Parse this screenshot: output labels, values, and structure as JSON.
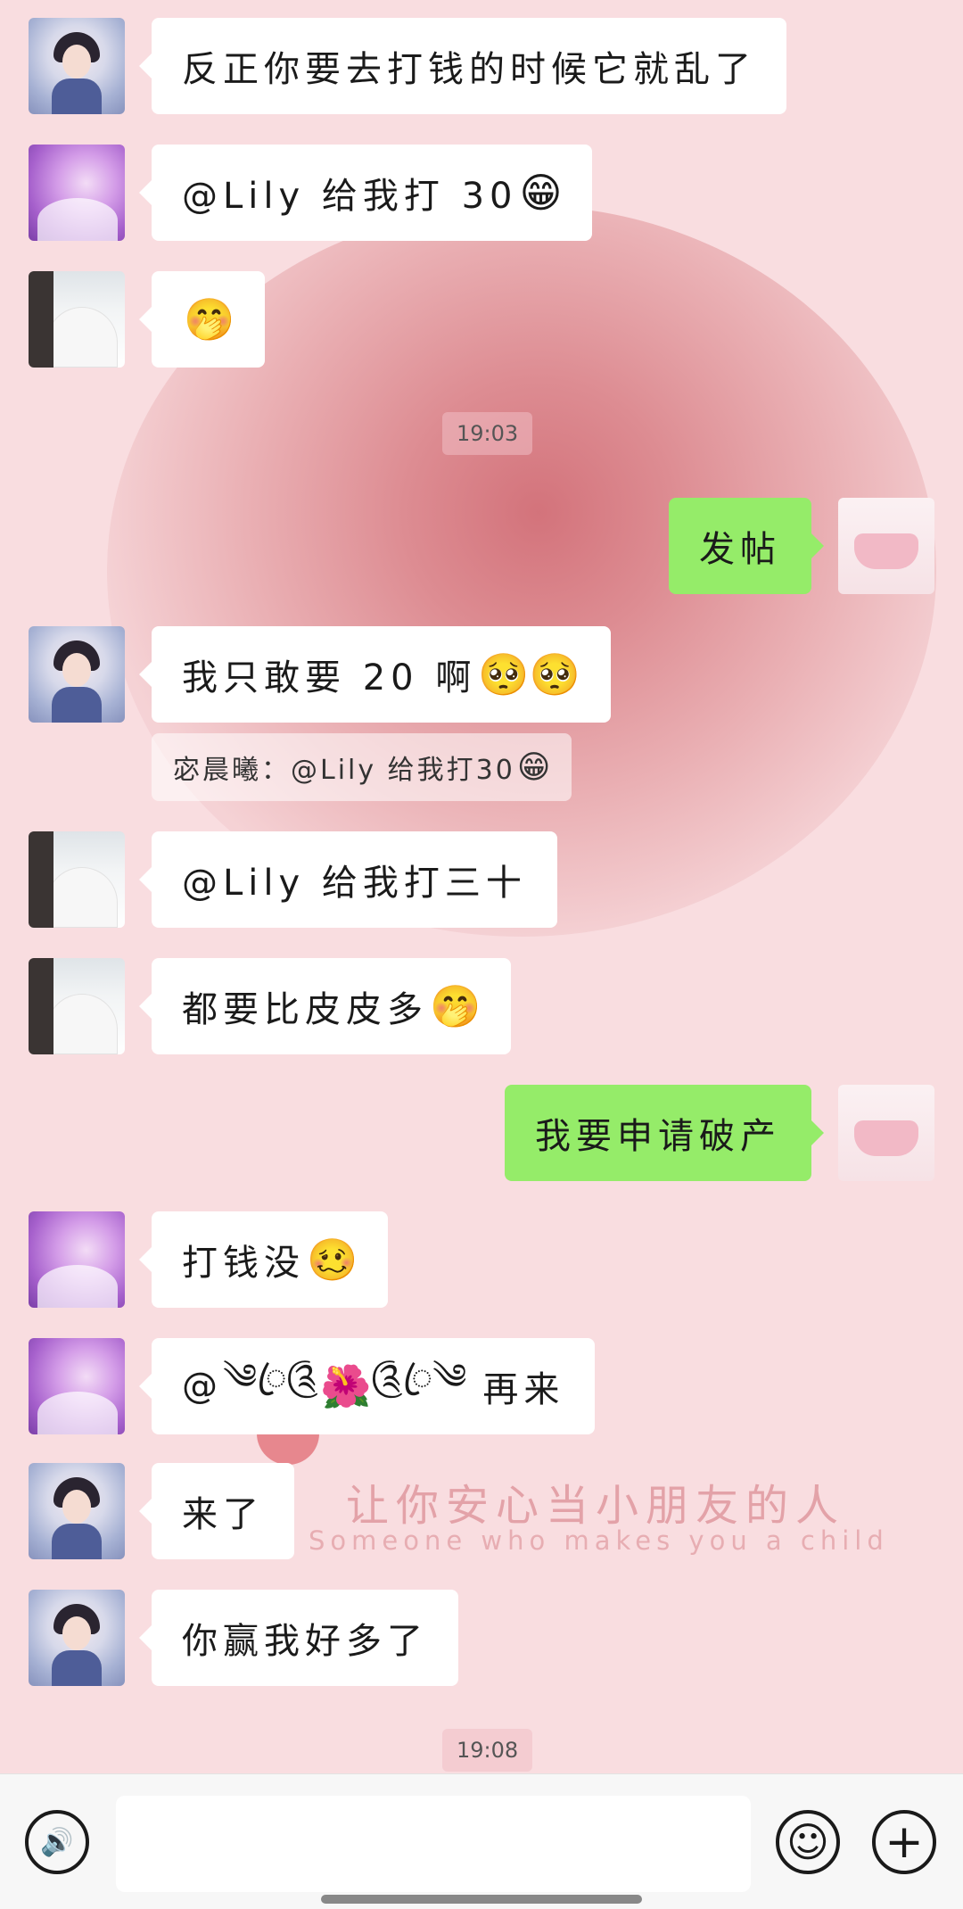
{
  "colors": {
    "background": "#f9dde0",
    "incoming_bubble": "#ffffff",
    "outgoing_bubble": "#95ec69",
    "bottom_bar": "#f7f7f7"
  },
  "watermark": {
    "chinese": "让你安心当小朋友的人",
    "english": "Someone who makes you a child"
  },
  "messages": [
    {
      "text": "反正你要去打钱的时候它就乱了",
      "emoji": ""
    },
    {
      "text": "@Lily 给我打 30",
      "emoji": "😁"
    },
    {
      "text": "",
      "emoji": "🤭"
    },
    {
      "text": "发帖",
      "emoji": ""
    },
    {
      "text": "我只敢要 20 啊",
      "emoji": "🥺🥺"
    },
    {
      "text": "@Lily 给我打三十",
      "emoji": ""
    },
    {
      "text": "都要比皮皮多",
      "emoji": "🤭"
    },
    {
      "text": "我要申请破产",
      "emoji": ""
    },
    {
      "text": "打钱没",
      "emoji": "🥴"
    },
    {
      "text": "再来",
      "emoji": "🌺",
      "mention_prefix": "@",
      "deco_left": "༄ꦿ༊",
      "deco_right": "༊ꦿ༄"
    },
    {
      "text": "来了",
      "emoji": ""
    },
    {
      "text": "你赢我好多了",
      "emoji": ""
    }
  ],
  "quote": {
    "text": "宓晨曦：@Lily 给我打30",
    "emoji": "😁"
  },
  "timestamps": [
    "19:03",
    "19:08"
  ],
  "input": {
    "value": "",
    "placeholder": ""
  },
  "icons": {
    "voice": "voice-icon",
    "emoji": "emoji-icon",
    "plus": "plus-icon"
  },
  "icon_glyphs": {
    "voice": "🔊",
    "emoji": "☺",
    "plus": "+"
  }
}
